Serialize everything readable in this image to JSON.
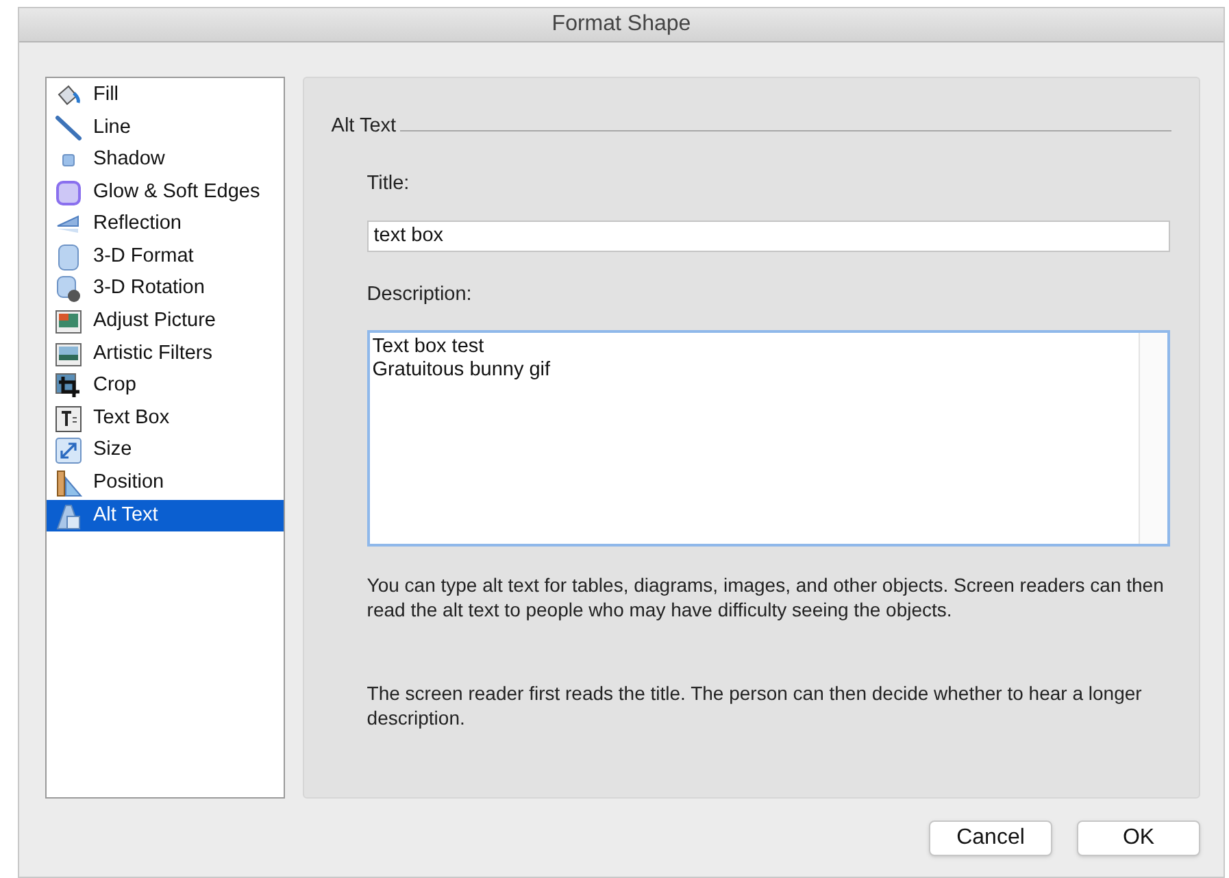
{
  "window": {
    "title": "Format Shape"
  },
  "sidebar": {
    "items": [
      {
        "label": "Fill",
        "selected": false
      },
      {
        "label": "Line",
        "selected": false
      },
      {
        "label": "Shadow",
        "selected": false
      },
      {
        "label": "Glow & Soft Edges",
        "selected": false
      },
      {
        "label": "Reflection",
        "selected": false
      },
      {
        "label": "3-D Format",
        "selected": false
      },
      {
        "label": "3-D Rotation",
        "selected": false
      },
      {
        "label": "Adjust Picture",
        "selected": false
      },
      {
        "label": "Artistic Filters",
        "selected": false
      },
      {
        "label": "Crop",
        "selected": false
      },
      {
        "label": "Text Box",
        "selected": false
      },
      {
        "label": "Size",
        "selected": false
      },
      {
        "label": "Position",
        "selected": false
      },
      {
        "label": "Alt Text",
        "selected": true
      }
    ]
  },
  "panel": {
    "heading": "Alt Text",
    "title_label": "Title:",
    "title_value": "text box",
    "description_label": "Description:",
    "description_value": "Text box test\nGratuitous bunny gif",
    "help": [
      "You can type alt text for tables, diagrams, images, and other objects. Screen readers can then read the alt text to people who may have difficulty seeing the objects.",
      "The screen reader first reads the title. The person can then decide whether to hear a longer description."
    ]
  },
  "buttons": [
    "Cancel",
    "OK"
  ]
}
